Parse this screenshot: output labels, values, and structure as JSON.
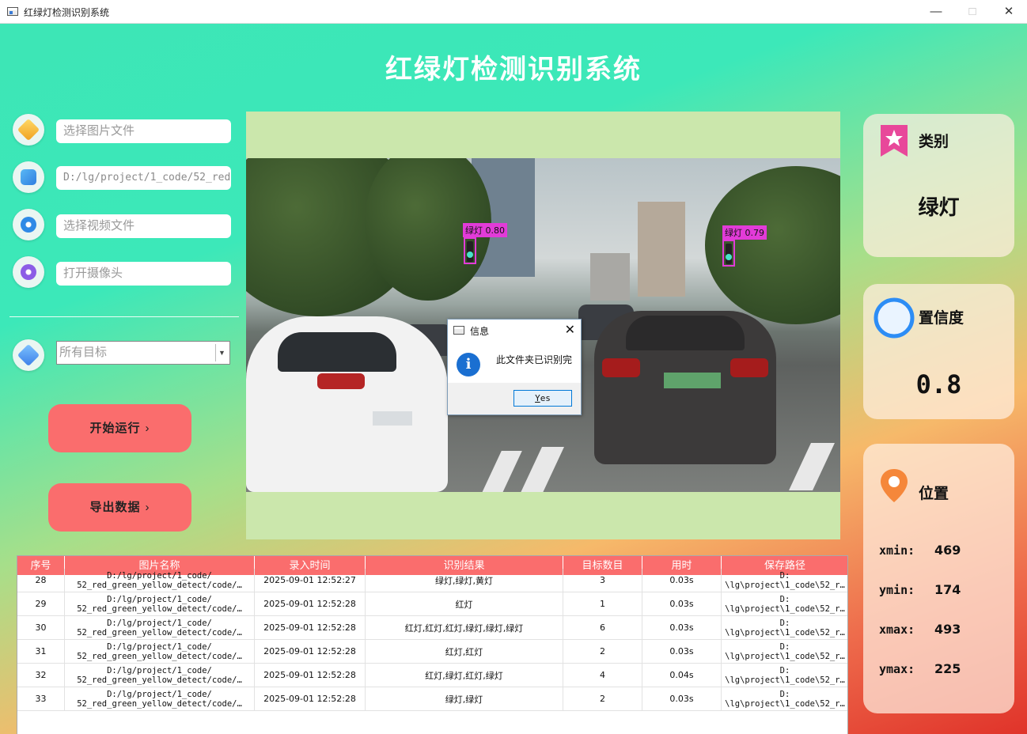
{
  "window": {
    "title": "红绿灯检测识别系统"
  },
  "app": {
    "title": "红绿灯检测识别系统"
  },
  "sidebar": {
    "image_field": "选择图片文件",
    "folder_field": "D:/lg/project/1_code/52_red",
    "video_field": "选择视频文件",
    "camera_field": "打开摄像头",
    "target_select": "所有目标",
    "start_button": "开始运行",
    "export_button": "导出数据",
    "chevron": "›"
  },
  "detections": [
    {
      "label": "绿灯 0.80"
    },
    {
      "label": "绿灯 0.79"
    }
  ],
  "dialog": {
    "title": "信息",
    "message": "此文件夹已识别完",
    "button_underlined": "Y",
    "button_rest": "es"
  },
  "cards": {
    "category": {
      "title": "类别",
      "value": "绿灯"
    },
    "confidence": {
      "title": "置信度",
      "value": "0.8"
    },
    "position": {
      "title": "位置",
      "xmin_label": "xmin:",
      "xmin": "469",
      "ymin_label": "ymin:",
      "ymin": "174",
      "xmax_label": "xmax:",
      "xmax": "493",
      "ymax_label": "ymax:",
      "ymax": "225"
    }
  },
  "table": {
    "headers": [
      "序号",
      "图片名称",
      "录入时间",
      "识别结果",
      "目标数目",
      "用时",
      "保存路径"
    ],
    "rows": [
      {
        "id": "28",
        "name1": "D:/lg/project/1_code/",
        "name2": "52_red_green_yellow_detect/code/…",
        "time": "2025-09-01 12:52:27",
        "result": "绿灯,绿灯,黄灯",
        "count": "3",
        "cost": "0.03s",
        "path1": "D:",
        "path2": "\\lg\\project\\1_code\\52_r…"
      },
      {
        "id": "29",
        "name1": "D:/lg/project/1_code/",
        "name2": "52_red_green_yellow_detect/code/…",
        "time": "2025-09-01 12:52:28",
        "result": "红灯",
        "count": "1",
        "cost": "0.03s",
        "path1": "D:",
        "path2": "\\lg\\project\\1_code\\52_r…"
      },
      {
        "id": "30",
        "name1": "D:/lg/project/1_code/",
        "name2": "52_red_green_yellow_detect/code/…",
        "time": "2025-09-01 12:52:28",
        "result": "红灯,红灯,红灯,绿灯,绿灯,绿灯",
        "count": "6",
        "cost": "0.03s",
        "path1": "D:",
        "path2": "\\lg\\project\\1_code\\52_r…"
      },
      {
        "id": "31",
        "name1": "D:/lg/project/1_code/",
        "name2": "52_red_green_yellow_detect/code/…",
        "time": "2025-09-01 12:52:28",
        "result": "红灯,红灯",
        "count": "2",
        "cost": "0.03s",
        "path1": "D:",
        "path2": "\\lg\\project\\1_code\\52_r…"
      },
      {
        "id": "32",
        "name1": "D:/lg/project/1_code/",
        "name2": "52_red_green_yellow_detect/code/…",
        "time": "2025-09-01 12:52:28",
        "result": "红灯,绿灯,红灯,绿灯",
        "count": "4",
        "cost": "0.04s",
        "path1": "D:",
        "path2": "\\lg\\project\\1_code\\52_r…"
      },
      {
        "id": "33",
        "name1": "D:/lg/project/1_code/",
        "name2": "52_red_green_yellow_detect/code/…",
        "time": "2025-09-01 12:52:28",
        "result": "绿灯,绿灯",
        "count": "2",
        "cost": "0.03s",
        "path1": "D:",
        "path2": "\\lg\\project\\1_code\\52_r…"
      }
    ]
  },
  "colors": {
    "button_bg": "#fa6d6d",
    "table_header_bg": "#fa6d6d",
    "detection_box": "#e23bd8",
    "image_frame_bg": "#cbe7ac"
  },
  "icons": {
    "window": "app-window-icon",
    "image": "layers-icon",
    "folder": "document-icon",
    "video": "film-reel-icon",
    "camera": "webcam-icon",
    "target": "tag-icon",
    "category": "bookmark-star-icon",
    "confidence": "ring-icon",
    "position": "location-pin-icon",
    "info": "info-icon"
  }
}
